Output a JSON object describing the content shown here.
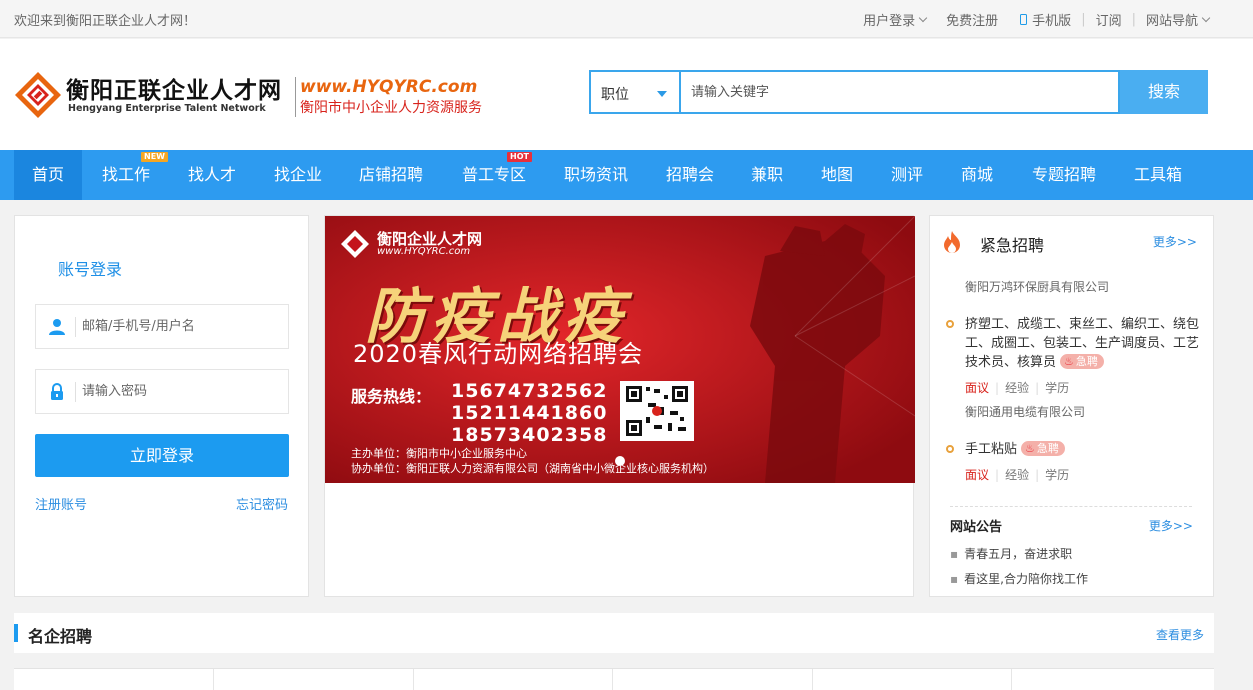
{
  "topbar": {
    "welcome": "欢迎来到衡阳正联企业人才网！",
    "login": "用户登录",
    "register": "免费注册",
    "mobile": "手机版",
    "subscribe": "订阅",
    "site_nav": "网站导航"
  },
  "header": {
    "logo_cn": "衡阳正联企业人才网",
    "logo_en": "Hengyang Enterprise Talent Network",
    "slogan_url": "www.HYQYRC.com",
    "slogan_cn": "衡阳市中小企业人力资源服务"
  },
  "search": {
    "type": "职位",
    "placeholder": "请输入关键字",
    "button": "搜索"
  },
  "nav": {
    "items": [
      {
        "label": "首页"
      },
      {
        "label": "找工作",
        "badge": "NEW"
      },
      {
        "label": "找人才"
      },
      {
        "label": "找企业"
      },
      {
        "label": "店铺招聘"
      },
      {
        "label": "普工专区",
        "badge": "HOT"
      },
      {
        "label": "职场资讯"
      },
      {
        "label": "招聘会"
      },
      {
        "label": "兼职"
      },
      {
        "label": "地图"
      },
      {
        "label": "测评"
      },
      {
        "label": "商城"
      },
      {
        "label": "专题招聘"
      },
      {
        "label": "工具箱"
      }
    ]
  },
  "login": {
    "title": "账号登录",
    "username_placeholder": "邮箱/手机号/用户名",
    "password_placeholder": "请输入密码",
    "submit": "立即登录",
    "register": "注册账号",
    "forgot": "忘记密码"
  },
  "banner": {
    "logo_cn": "衡阳企业人才网",
    "logo_en": "www.HYQYRC.com",
    "title": "防疫战疫",
    "subtitle": "2020春风行动网络招聘会",
    "hotline_label": "服务热线：",
    "phones": [
      "15674732562",
      "15211441860",
      "18573402358"
    ],
    "host": "主办单位：衡阳市中小企业服务中心",
    "co_host": "协办单位：衡阳正联人力资源有限公司（湖南省中小微企业核心服务机构）"
  },
  "urgent": {
    "title": "紧急招聘",
    "more": "更多>>",
    "top_company": "衡阳万鸿环保厨具有限公司",
    "tag": "急聘",
    "jobs": [
      {
        "title": "挤塑工、成缆工、束丝工、编织工、绕包工、成圈工、包装工、生产调度员、工艺技术员、核算员",
        "salary": "面议",
        "experience": "经验",
        "education": "学历",
        "company": "衡阳通用电缆有限公司"
      },
      {
        "title": "手工粘贴",
        "salary": "面议",
        "experience": "经验",
        "education": "学历"
      }
    ]
  },
  "notice": {
    "title": "网站公告",
    "more": "更多>>",
    "items": [
      "青春五月，奋进求职",
      "看这里,合力陪你找工作"
    ]
  },
  "famous": {
    "title": "名企招聘",
    "more": "查看更多"
  },
  "colors": {
    "primary": "#2d9bf0",
    "link": "#2d8ee0",
    "salary": "#d8231c",
    "banner_red": "#c4141c"
  }
}
